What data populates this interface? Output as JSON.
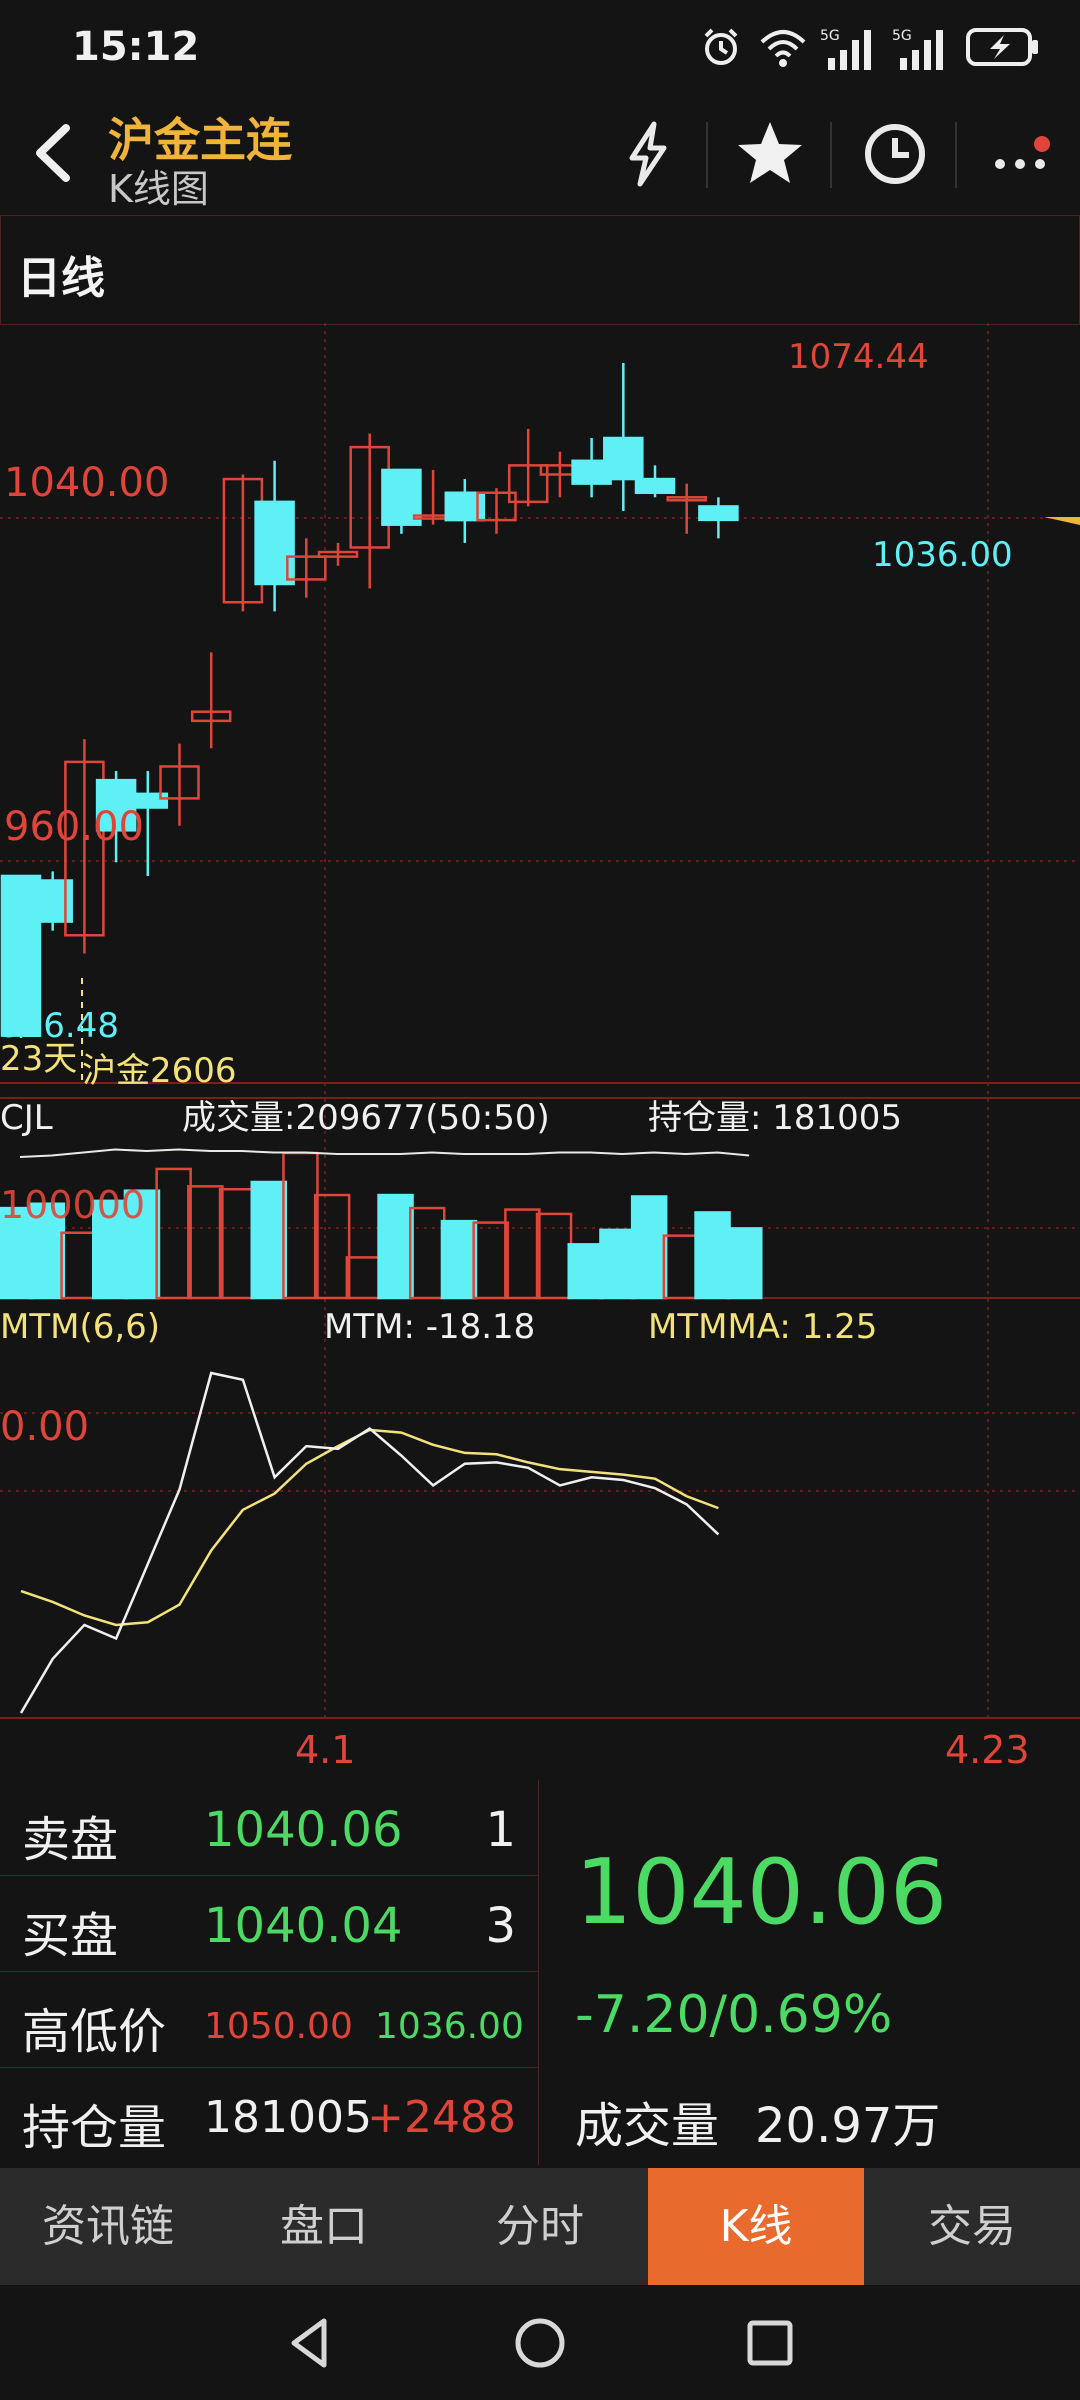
{
  "status": {
    "time": "15:12",
    "net1": "5G",
    "net2": "5G"
  },
  "header": {
    "title": "沪金主连",
    "subtitle": "K线图"
  },
  "timeframe": "日线",
  "chart_data": {
    "type": "candlestick",
    "candles": [
      {
        "o": 962,
        "h": 962,
        "l": 926.48,
        "c": 927
      },
      {
        "o": 961,
        "h": 963,
        "l": 950,
        "c": 952
      },
      {
        "o": 949,
        "h": 992,
        "l": 945,
        "c": 987
      },
      {
        "o": 983,
        "h": 985,
        "l": 965,
        "c": 972
      },
      {
        "o": 980,
        "h": 985,
        "l": 962,
        "c": 977
      },
      {
        "o": 979,
        "h": 991,
        "l": 973,
        "c": 986
      },
      {
        "o": 996,
        "h": 1011,
        "l": 990,
        "c": 998
      },
      {
        "o": 1022,
        "h": 1050,
        "l": 1020,
        "c": 1049
      },
      {
        "o": 1044,
        "h": 1053,
        "l": 1020,
        "c": 1026
      },
      {
        "o": 1027,
        "h": 1036,
        "l": 1023,
        "c": 1032
      },
      {
        "o": 1032,
        "h": 1035,
        "l": 1030,
        "c": 1033
      },
      {
        "o": 1034,
        "h": 1059,
        "l": 1025,
        "c": 1056
      },
      {
        "o": 1051,
        "h": 1050,
        "l": 1037,
        "c": 1039
      },
      {
        "o": 1041,
        "h": 1051,
        "l": 1039,
        "c": 1041
      },
      {
        "o": 1046,
        "h": 1049,
        "l": 1035,
        "c": 1040
      },
      {
        "o": 1040,
        "h": 1047,
        "l": 1037,
        "c": 1046
      },
      {
        "o": 1044,
        "h": 1060,
        "l": 1043,
        "c": 1052
      },
      {
        "o": 1050,
        "h": 1055,
        "l": 1045,
        "c": 1052
      },
      {
        "o": 1053,
        "h": 1058,
        "l": 1045,
        "c": 1048
      },
      {
        "o": 1058,
        "h": 1074.44,
        "l": 1042,
        "c": 1049
      },
      {
        "o": 1049,
        "h": 1052,
        "l": 1045,
        "c": 1046
      },
      {
        "o": 1045,
        "h": 1048,
        "l": 1037,
        "c": 1045
      },
      {
        "o": 1043,
        "h": 1045,
        "l": 1036,
        "c": 1040.06
      }
    ],
    "price_labels": {
      "level1": "1040.00",
      "level2": "960.00",
      "hi": "1074.44",
      "lo": "1036.00",
      "low_first": "926.48"
    },
    "range_label": "23天",
    "contract": "沪金2606",
    "volume_panel": {
      "name": "CJL",
      "vol_label": "成交量:209677(50:50)",
      "oi_label": "持仓量: 181005",
      "axis_label": "100000",
      "bars": [
        62,
        65,
        45,
        67,
        74,
        89,
        77,
        75,
        80,
        100,
        71,
        28,
        71,
        62,
        53,
        52,
        61,
        58,
        37,
        47,
        70,
        43,
        59,
        48
      ],
      "oi_line": [
        94,
        95,
        97,
        99,
        98,
        99,
        98,
        98,
        97,
        97,
        96,
        96,
        96,
        97,
        96,
        96,
        96,
        97,
        97,
        96,
        97,
        96,
        97,
        95
      ]
    },
    "mtm_panel": {
      "name": "MTM(6,6)",
      "mtm_label": "MTM: -18.18",
      "mtmma_label": "MTMMA: 1.25",
      "axis_label": "0.00",
      "mtm": [
        -150,
        -110,
        -85,
        -95,
        -40,
        15,
        101,
        96,
        24,
        47,
        45,
        60,
        40,
        18,
        34,
        35,
        31,
        18,
        24,
        22,
        16,
        4,
        -18.18
      ],
      "mtmma": [
        -60,
        -68,
        -78,
        -85,
        -83,
        -70,
        -30,
        0,
        12,
        34,
        47,
        59,
        57,
        48,
        42,
        41,
        35,
        30,
        28,
        26,
        23,
        10,
        1.25
      ]
    },
    "x_labels": [
      "4.1",
      "4.23"
    ]
  },
  "quote": {
    "ask_label": "卖盘",
    "ask_price": "1040.06",
    "ask_vol": "1",
    "bid_label": "买盘",
    "bid_price": "1040.04",
    "bid_vol": "3",
    "hilo_label": "高低价",
    "high": "1050.00",
    "low": "1036.00",
    "oi_label": "持仓量",
    "oi": "181005",
    "oi_change": "+2488",
    "last_price": "1040.06",
    "change": "-7.20/0.69%",
    "turnover_label": "成交量",
    "turnover": "20.97万"
  },
  "tabs": [
    {
      "label": "资讯链",
      "active": false
    },
    {
      "label": "盘口",
      "active": false
    },
    {
      "label": "分时",
      "active": false
    },
    {
      "label": "K线",
      "active": true
    },
    {
      "label": "交易",
      "active": false
    }
  ],
  "colors": {
    "up": "#e0453a",
    "down": "#5ef0f5",
    "grid": "#7a1e1e",
    "accent": "#f1b43b",
    "ma": "#f3e27a"
  }
}
